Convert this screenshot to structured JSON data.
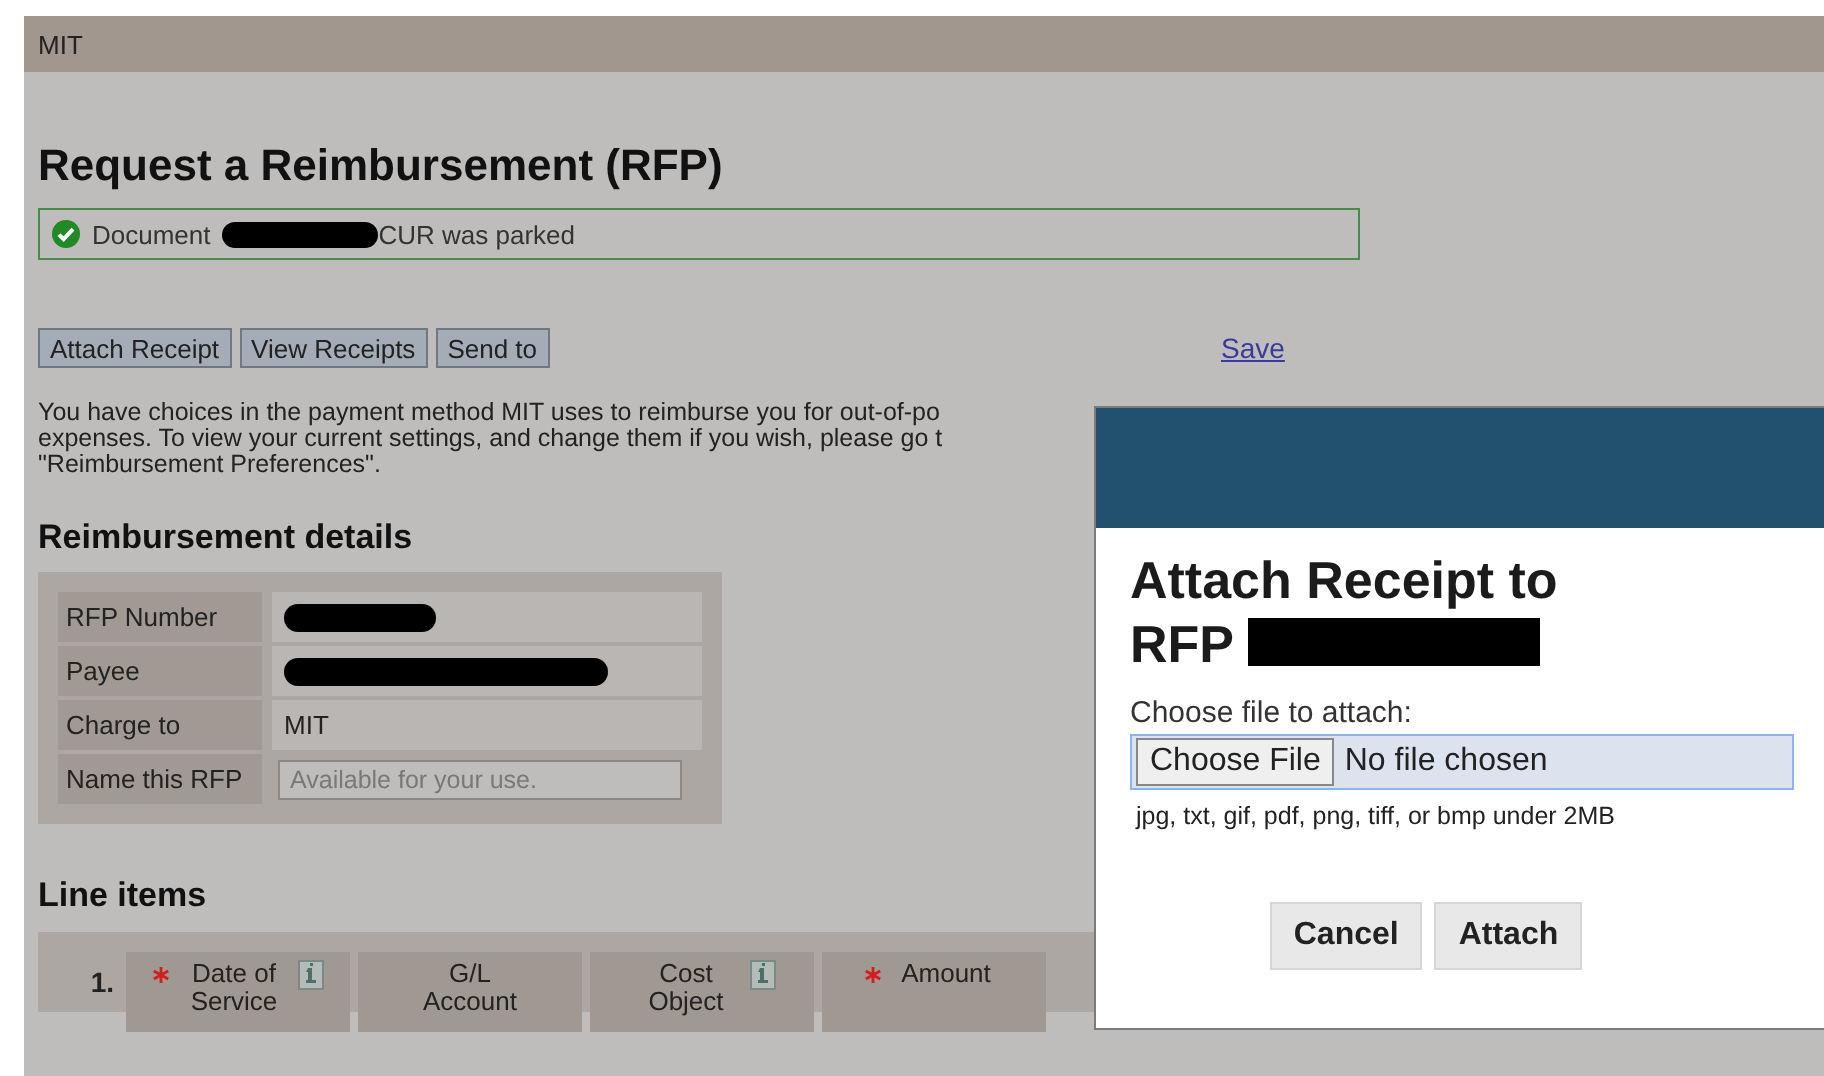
{
  "header": {
    "org": "MIT"
  },
  "title": "Request a Reimbursement (RFP)",
  "message": {
    "kind": "success",
    "before": "Document",
    "after": "CUR was parked",
    "redacted": true
  },
  "actions": [
    {
      "label": "Attach Receipt"
    },
    {
      "label": "View Receipts"
    },
    {
      "label": "Send to"
    }
  ],
  "save_link": "Save",
  "intro_lines": [
    "You have choices in the payment method MIT uses to reimburse you for out-of-po",
    "expenses. To view your current settings, and change them if you wish, please go t",
    "\"Reimbursement Preferences\"."
  ],
  "details": {
    "heading": "Reimbursement details",
    "rows": [
      {
        "label": "RFP Number",
        "kind": "redacted"
      },
      {
        "label": "Payee",
        "kind": "redacted"
      },
      {
        "label": "Charge to",
        "kind": "text",
        "value": "MIT"
      },
      {
        "label": "Name this RFP",
        "kind": "input",
        "placeholder": "Available for your use."
      }
    ]
  },
  "line_items": {
    "heading": "Line items",
    "number": "1.",
    "columns": [
      {
        "label": "Date of Service",
        "required": true,
        "info": true
      },
      {
        "label": "G/L Account",
        "required": false,
        "info": false
      },
      {
        "label": "Cost Object",
        "required": false,
        "info": true
      },
      {
        "label": "Amount",
        "required": true,
        "info": false
      }
    ]
  },
  "dialog": {
    "title": "Attach Receipt to RFP",
    "redacted": true,
    "file_label": "Choose file to attach:",
    "file_button": "Choose File",
    "file_status": "No file chosen",
    "hint": "jpg, txt, gif, pdf, png, tiff, or bmp under 2MB",
    "buttons": [
      "Cancel",
      "Attach"
    ]
  }
}
